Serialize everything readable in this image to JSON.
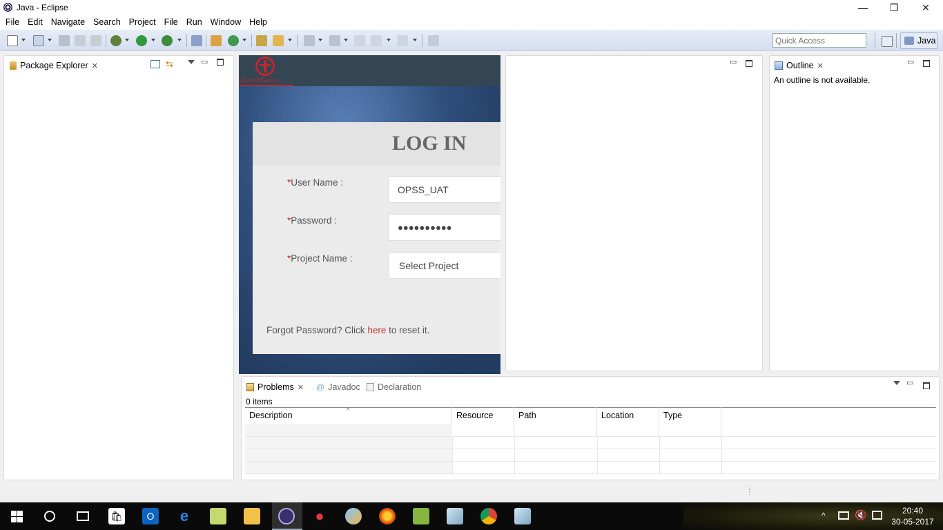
{
  "window": {
    "title": "Java - Eclipse",
    "controls": {
      "minimize": "—",
      "restore": "❐",
      "close": "✕"
    }
  },
  "menubar": [
    "File",
    "Edit",
    "Navigate",
    "Search",
    "Project",
    "File",
    "Run",
    "Window",
    "Help"
  ],
  "toolbar": {
    "quick_access_placeholder": "Quick Access",
    "perspective_label": "Java"
  },
  "package_explorer": {
    "tab_label": "Package Explorer"
  },
  "login_page": {
    "logo_text": "AutoMatics",
    "title": "LOG IN",
    "username_label": "User Name :",
    "username_value": "OPSS_UAT",
    "password_label": "Password :",
    "password_value": "●●●●●●●●●●",
    "project_label": "Project Name :",
    "project_value": "Select Project",
    "required_mark": "*",
    "forgot_prefix": "Forgot Password? Click ",
    "forgot_link": "here",
    "forgot_suffix": " to reset it."
  },
  "outline": {
    "tab_label": "Outline",
    "message": "An outline is not available."
  },
  "bottom_panel": {
    "tabs": [
      {
        "label": "Problems",
        "active": true
      },
      {
        "label": "Javadoc",
        "active": false
      },
      {
        "label": "Declaration",
        "active": false
      }
    ],
    "item_count": "0 items",
    "columns": [
      "Description",
      "Resource",
      "Path",
      "Location",
      "Type"
    ]
  },
  "taskbar": {
    "time": "20:40",
    "date": "30-05-2017"
  },
  "colors": {
    "toolbar_bg": "#dbe3f1",
    "link_red": "#d32f2f",
    "taskbar_bg": "#0a0a0a"
  }
}
